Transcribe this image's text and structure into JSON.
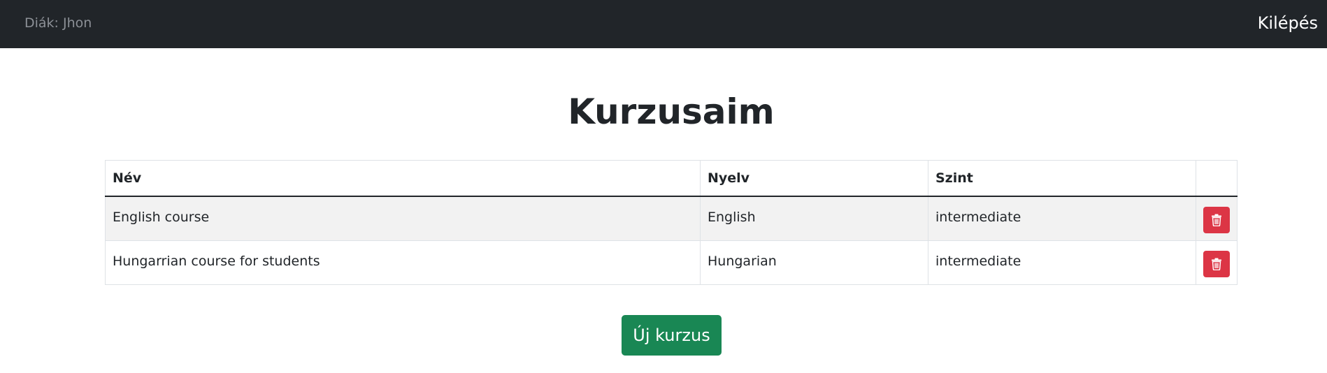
{
  "navbar": {
    "user_label": "Diák: Jhon",
    "logout_label": "Kilépés"
  },
  "page": {
    "title": "Kurzusaim"
  },
  "table": {
    "headers": {
      "name": "Név",
      "language": "Nyelv",
      "level": "Szint"
    },
    "rows": [
      {
        "name": "English course",
        "language": "English",
        "level": "intermediate"
      },
      {
        "name": "Hungarrian course for students",
        "language": "Hungarian",
        "level": "intermediate"
      }
    ]
  },
  "actions": {
    "new_course_label": "Új kurzus"
  },
  "icons": {
    "delete": "trash-icon"
  },
  "colors": {
    "navbar_bg": "#212529",
    "danger": "#dc3545",
    "success": "#198754",
    "stripe": "#f2f2f2"
  }
}
